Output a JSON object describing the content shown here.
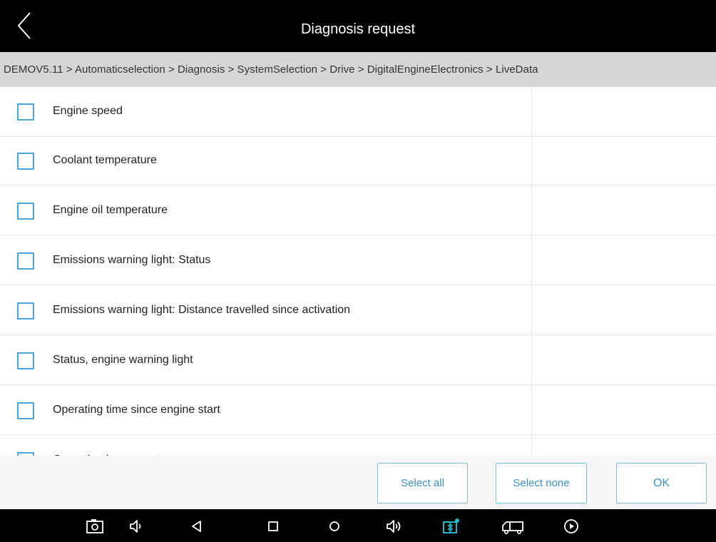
{
  "header": {
    "title": "Diagnosis request",
    "back_icon": "chevron-left-icon"
  },
  "breadcrumb": {
    "text": "DEMOV5.11 > Automaticselection > Diagnosis > SystemSelection > Drive > DigitalEngineElectronics > LiveData"
  },
  "list": {
    "items": [
      {
        "label": "Engine speed",
        "checked": false
      },
      {
        "label": "Coolant temperature",
        "checked": false
      },
      {
        "label": "Engine oil temperature",
        "checked": false
      },
      {
        "label": "Emissions warning light: Status",
        "checked": false
      },
      {
        "label": "Emissions warning light: Distance travelled since activation",
        "checked": false
      },
      {
        "label": "Status, engine warning light",
        "checked": false
      },
      {
        "label": "Operating time since engine start",
        "checked": false
      },
      {
        "label": "Operating hour counter",
        "checked": false
      }
    ]
  },
  "footer": {
    "select_all": "Select all",
    "select_none": "Select none",
    "ok": "OK"
  },
  "navbar": {
    "icons": [
      "screenshot-icon",
      "volume-down-icon",
      "back-triangle-icon",
      "recent-apps-icon",
      "home-icon",
      "volume-up-icon",
      "vci-connection-icon",
      "truck-icon",
      "play-icon"
    ]
  },
  "colors": {
    "accent": "#3a8fd0",
    "checkbox_border": "#4da6d9",
    "breadcrumb_bg": "#d6d6d6",
    "bar_bg": "#000000",
    "vci_icon": "#22b8c8"
  }
}
